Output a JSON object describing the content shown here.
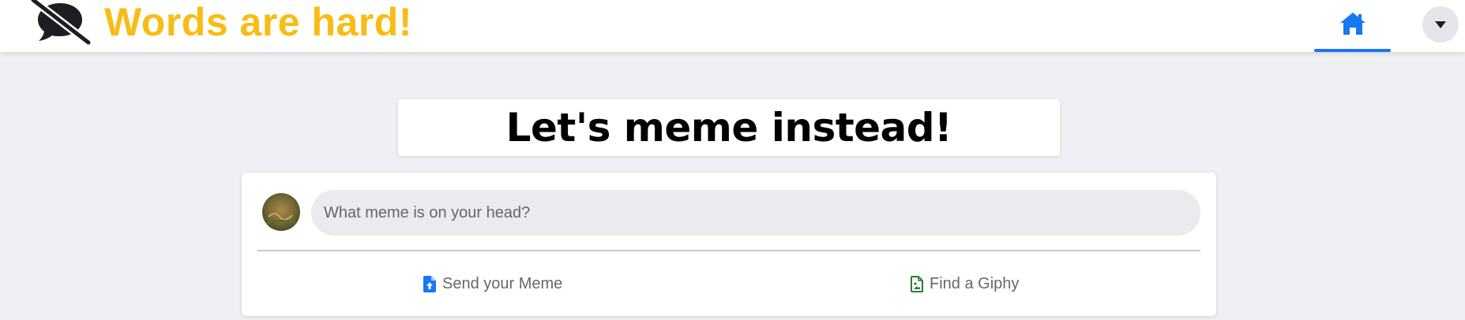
{
  "header": {
    "brand": "Words are hard!",
    "logo_icon": "no-speech-bubble-icon",
    "brand_color": "#f9bc15",
    "nav": {
      "home_icon": "home-icon",
      "home_active": true,
      "accent": "#1877f2"
    },
    "account_menu_icon": "caret-down-icon"
  },
  "main": {
    "headline": "Let's meme instead!",
    "composer": {
      "avatar_icon": "user-avatar",
      "placeholder": "What meme is on your head?",
      "value": "",
      "actions": [
        {
          "label": "Send your Meme",
          "icon": "file-upload-icon",
          "icon_color": "#1877f2"
        },
        {
          "label": "Find a Giphy",
          "icon": "file-image-icon",
          "icon_color": "#2e7d32"
        }
      ]
    }
  }
}
